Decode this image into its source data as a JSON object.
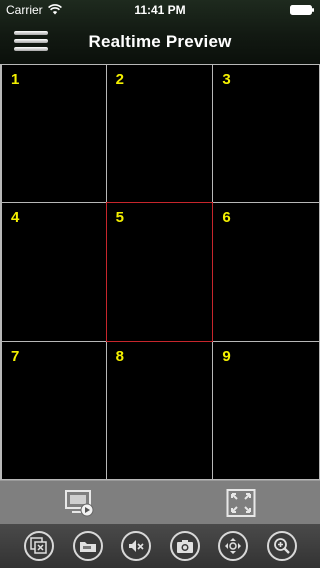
{
  "status_bar": {
    "carrier": "Carrier",
    "time": "11:41 PM"
  },
  "nav": {
    "title": "Realtime Preview"
  },
  "grid": {
    "cells": [
      "1",
      "2",
      "3",
      "4",
      "5",
      "6",
      "7",
      "8",
      "9"
    ],
    "selected_cell": "5",
    "number_color": "#f4f000",
    "selected_border_color": "#c7262c"
  },
  "toolbar_mid": {
    "icons": [
      "monitor-play-icon",
      "fullscreen-icon"
    ]
  },
  "toolbar_bottom": {
    "icons": [
      "close-all-icon",
      "folder-icon",
      "mute-icon",
      "camera-icon",
      "ptz-icon",
      "zoom-in-icon"
    ]
  }
}
